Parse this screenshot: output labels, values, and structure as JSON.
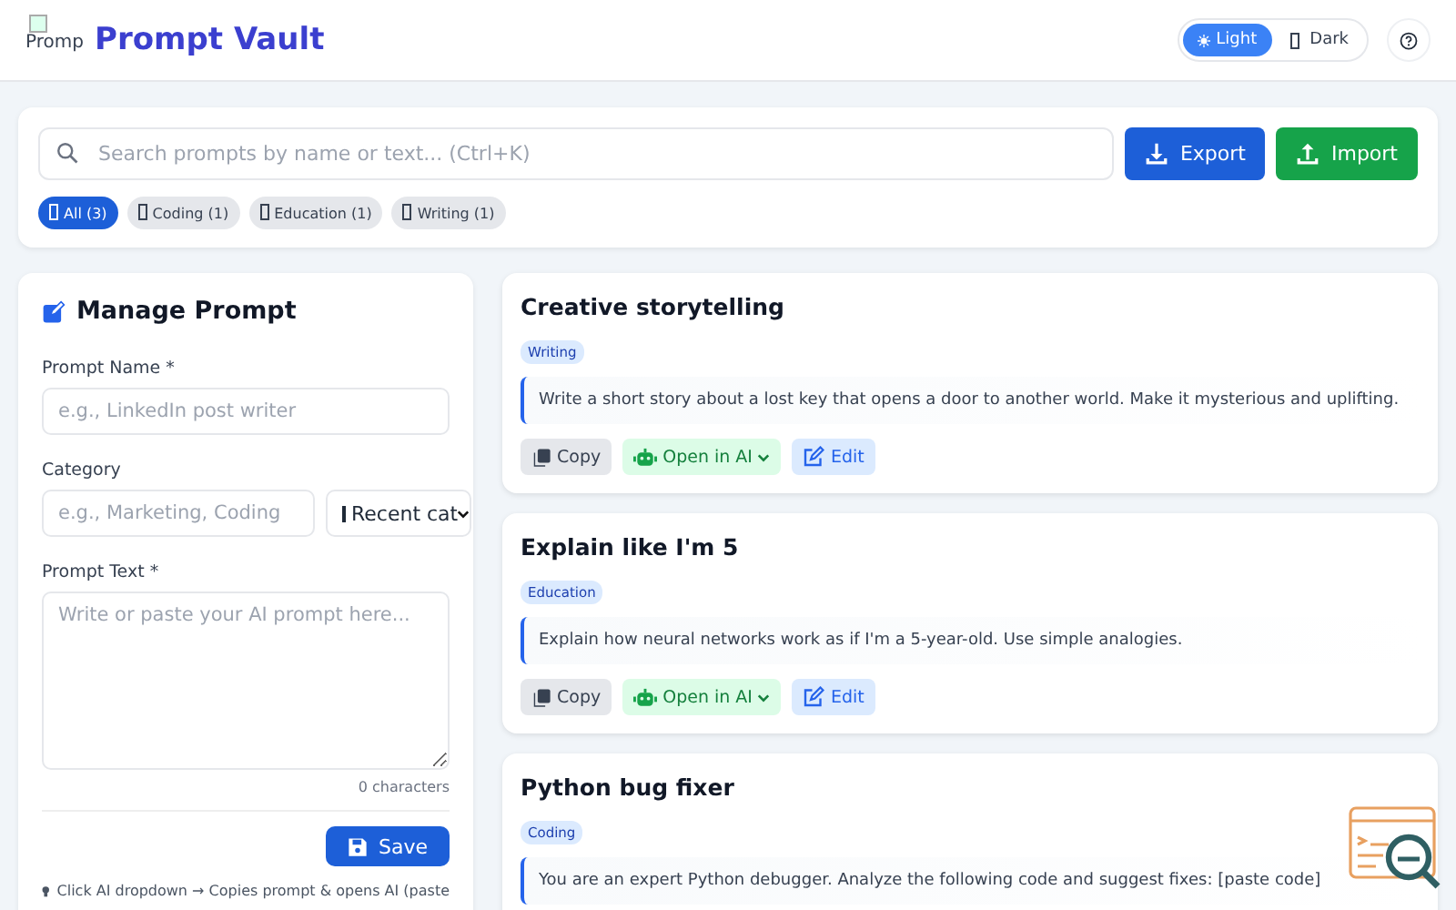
{
  "header": {
    "logo_alt": "Promp",
    "title": "Prompt Vault",
    "theme_options": [
      {
        "label": "Light",
        "kind": "light",
        "selected": true
      },
      {
        "label": "Dark",
        "kind": "dark",
        "selected": false
      }
    ]
  },
  "toolbar": {
    "search": {
      "placeholder": "Search prompts by name or text... (Ctrl+K)"
    },
    "buttons": [
      {
        "label": "Export",
        "kind": "export"
      },
      {
        "label": "Import",
        "kind": "import"
      }
    ],
    "filters": [
      {
        "label": "All (3)",
        "selected": true
      },
      {
        "label": "Coding (1)",
        "selected": false
      },
      {
        "label": "Education (1)",
        "selected": false
      },
      {
        "label": "Writing (1)",
        "selected": false
      }
    ]
  },
  "form": {
    "title": "Manage Prompt",
    "name": {
      "label": "Prompt Name *",
      "placeholder": "e.g., LinkedIn post writer"
    },
    "category": {
      "label": "Category",
      "placeholder": "e.g., Marketing, Coding",
      "select": "Recent cat"
    },
    "text": {
      "label": "Prompt Text *",
      "placeholder": "Write or paste your AI prompt here..."
    },
    "count": "0 characters",
    "save": "Save",
    "hint": "Click AI dropdown → Copies prompt & opens AI (paste"
  },
  "prompts": [
    {
      "title": "Creative storytelling",
      "tag": "Writing",
      "text": "Write a short story about a lost key that opens a door to another world. Make it mysterious and uplifting.",
      "actions": [
        {
          "label": "Copy",
          "kind": "copy"
        },
        {
          "label": "Open in AI",
          "kind": "ai"
        },
        {
          "label": "Edit",
          "kind": "edit"
        }
      ]
    },
    {
      "title": "Explain like I'm 5",
      "tag": "Education",
      "text": "Explain how neural networks work as if I'm a 5-year-old. Use simple analogies.",
      "actions": [
        {
          "label": "Copy",
          "kind": "copy"
        },
        {
          "label": "Open in AI",
          "kind": "ai"
        },
        {
          "label": "Edit",
          "kind": "edit"
        }
      ]
    },
    {
      "title": "Python bug fixer",
      "tag": "Coding",
      "text": "You are an expert Python debugger. Analyze the following code and suggest fixes: [paste code]"
    }
  ]
}
